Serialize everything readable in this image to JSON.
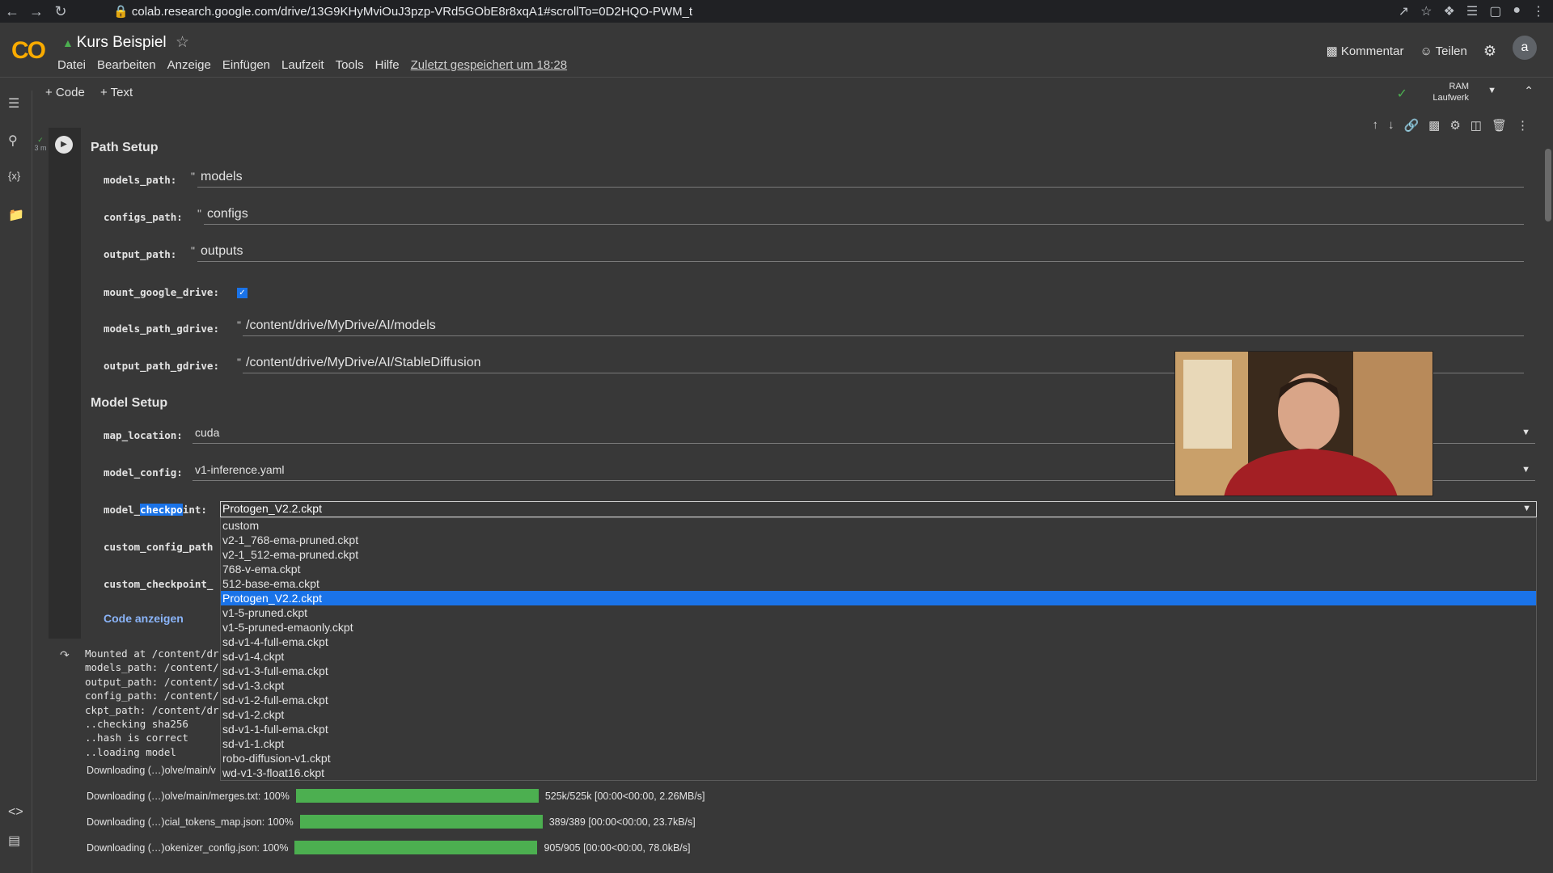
{
  "browser": {
    "url_host": "colab.research.google.com",
    "url_path": "/drive/13G9KHyMviOuJ3pzp-VRd5GObE8r8xqA1#scrollTo=0D2HQO-PWM_t"
  },
  "header": {
    "logo": "CO",
    "title": "Kurs Beispiel",
    "menu": [
      "Datei",
      "Bearbeiten",
      "Anzeige",
      "Einfügen",
      "Laufzeit",
      "Tools",
      "Hilfe"
    ],
    "saved_status": "Zuletzt gespeichert um 18:28",
    "comment_label": "Kommentar",
    "share_label": "Teilen",
    "avatar_letter": "a"
  },
  "toolbar": {
    "add_code": "+ Code",
    "add_text": "+ Text",
    "ram_label": "RAM",
    "disk_label": "Laufwerk"
  },
  "cell": {
    "exec_time": "3 m",
    "path_section": "Path Setup",
    "model_section": "Model Setup",
    "params": {
      "models_path": {
        "label": "models_path:",
        "value": "models"
      },
      "configs_path": {
        "label": "configs_path:",
        "value": "configs"
      },
      "output_path": {
        "label": "output_path:",
        "value": "outputs"
      },
      "mount_google_drive": {
        "label": "mount_google_drive:",
        "checked": true
      },
      "models_path_gdrive": {
        "label": "models_path_gdrive:",
        "value": "/content/drive/MyDrive/AI/models"
      },
      "output_path_gdrive": {
        "label": "output_path_gdrive:",
        "value": "/content/drive/MyDrive/AI/StableDiffusion"
      },
      "map_location": {
        "label": "map_location:",
        "value": "cuda"
      },
      "model_config": {
        "label": "model_config:",
        "value": "v1-inference.yaml"
      },
      "model_checkpoint": {
        "label_pre": "model_",
        "label_hl": "checkpo",
        "label_post": "int:",
        "value": "Protogen_V2.2.ckpt"
      },
      "custom_config_path": {
        "label": "custom_config_path"
      },
      "custom_checkpoint_path": {
        "label": "custom_checkpoint_"
      }
    },
    "checkpoint_options": [
      "custom",
      "v2-1_768-ema-pruned.ckpt",
      "v2-1_512-ema-pruned.ckpt",
      "768-v-ema.ckpt",
      "512-base-ema.ckpt",
      "Protogen_V2.2.ckpt",
      "v1-5-pruned.ckpt",
      "v1-5-pruned-emaonly.ckpt",
      "sd-v1-4-full-ema.ckpt",
      "sd-v1-4.ckpt",
      "sd-v1-3-full-ema.ckpt",
      "sd-v1-3.ckpt",
      "sd-v1-2-full-ema.ckpt",
      "sd-v1-2.ckpt",
      "sd-v1-1-full-ema.ckpt",
      "sd-v1-1.ckpt",
      "robo-diffusion-v1.ckpt",
      "wd-v1-3-float16.ckpt"
    ],
    "selected_option": "Protogen_V2.2.ckpt",
    "code_link": "Code anzeigen"
  },
  "output": {
    "lines": [
      "Mounted at /content/dr",
      "models_path: /content/",
      "output_path: /content/",
      "config_path: /content/",
      "ckpt_path: /content/dr",
      "..checking sha256",
      "..hash is correct",
      "..loading model"
    ],
    "partial_download": "Downloading (…)olve/main/v",
    "downloads": [
      {
        "label": "Downloading (…)olve/main/merges.txt: 100%",
        "progress": 1.0,
        "stats": "525k/525k [00:00<00:00, 2.26MB/s]"
      },
      {
        "label": "Downloading (…)cial_tokens_map.json: 100%",
        "progress": 1.0,
        "stats": "389/389 [00:00<00:00, 23.7kB/s]"
      },
      {
        "label": "Downloading (…)okenizer_config.json: 100%",
        "progress": 1.0,
        "stats": "905/905 [00:00<00:00, 78.0kB/s]"
      }
    ]
  }
}
